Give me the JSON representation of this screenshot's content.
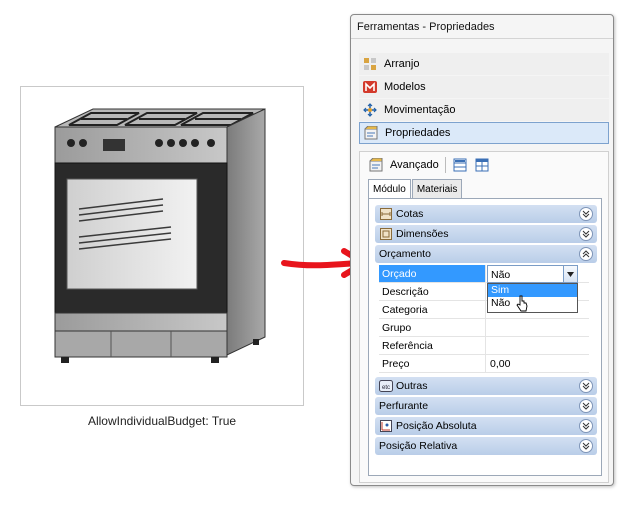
{
  "caption": "AllowIndividualBudget: True",
  "window": {
    "title": "Ferramentas - Propriedades"
  },
  "nav": {
    "items": [
      {
        "label": "Arranjo",
        "icon": "arrangement-icon"
      },
      {
        "label": "Modelos",
        "icon": "models-icon"
      },
      {
        "label": "Movimentação",
        "icon": "move-icon"
      },
      {
        "label": "Propriedades",
        "icon": "properties-icon",
        "selected": true
      }
    ]
  },
  "toolbar": {
    "advanced_label": "Avançado"
  },
  "tabs": [
    {
      "label": "Módulo",
      "active": true
    },
    {
      "label": "Materiais",
      "active": false
    }
  ],
  "sections": {
    "cotas": "Cotas",
    "dimensoes": "Dimensões",
    "orcamento": "Orçamento",
    "outras": "Outras",
    "perfurante": "Perfurante",
    "posicao_absoluta": "Posição Absoluta",
    "posicao_relativa": "Posição Relativa"
  },
  "budget_props": [
    {
      "name": "Orçado",
      "value": "Não"
    },
    {
      "name": "Descrição",
      "value": ""
    },
    {
      "name": "Categoria",
      "value": ""
    },
    {
      "name": "Grupo",
      "value": ""
    },
    {
      "name": "Referência",
      "value": ""
    },
    {
      "name": "Preço",
      "value": "0,00"
    }
  ],
  "dropdown": {
    "options": [
      "Sim",
      "Não"
    ],
    "highlighted": "Sim"
  },
  "colors": {
    "arrow": "#e8141c",
    "selection": "#3399ff",
    "section_bar": "#c6d6ee"
  }
}
